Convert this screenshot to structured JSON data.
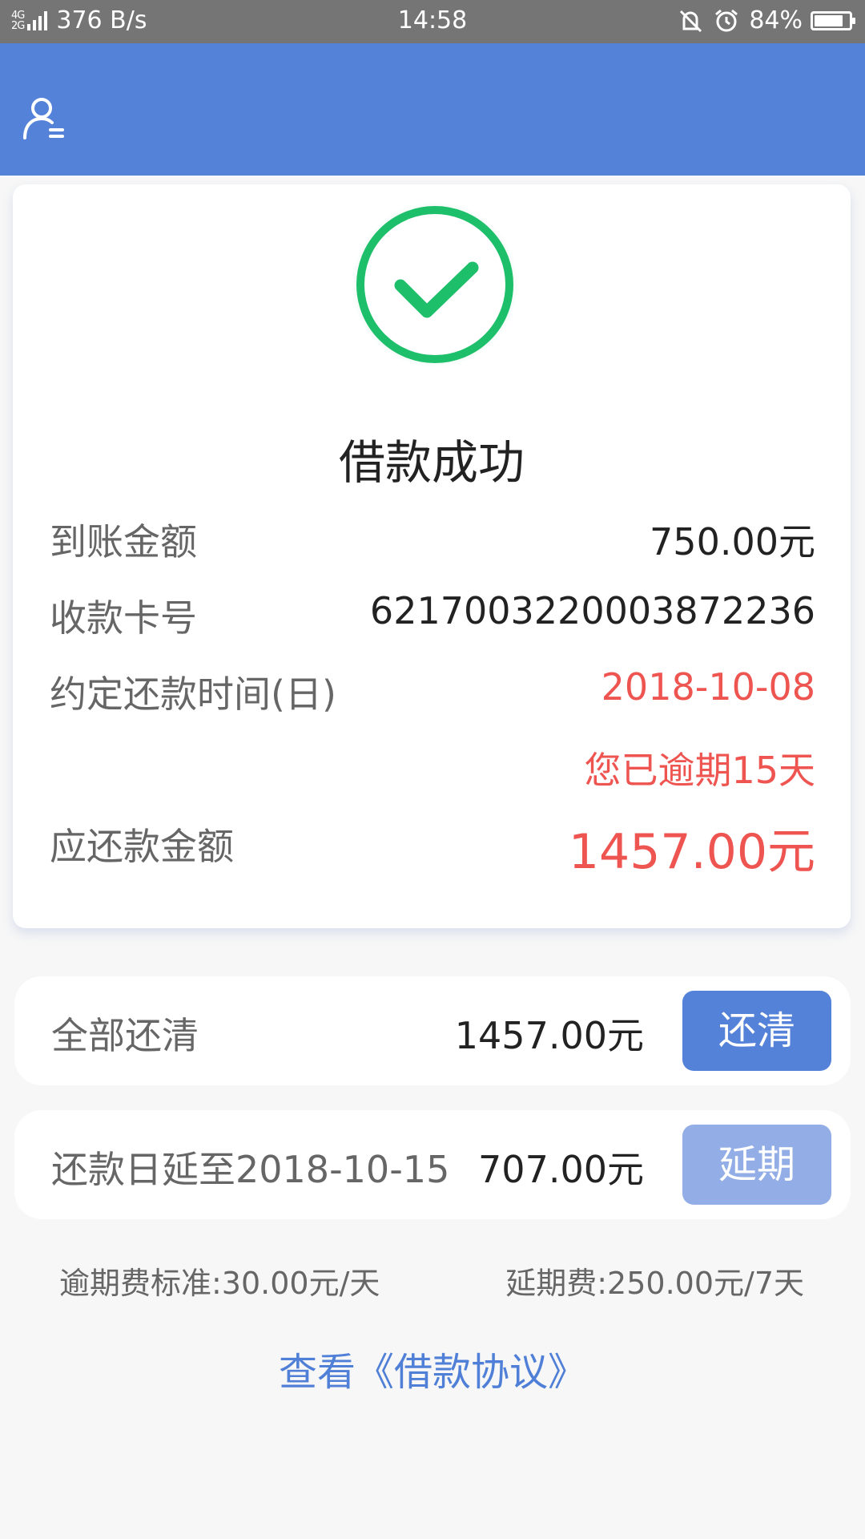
{
  "status_bar": {
    "network": "4G 2G",
    "speed": "376 B/s",
    "time": "14:58",
    "battery_percent": "84%",
    "battery_level": 0.84,
    "icons": [
      "signal-icon",
      "vibrate-mute-icon",
      "alarm-icon",
      "battery-icon"
    ]
  },
  "header": {
    "user_icon": "user-menu-icon",
    "accent_color": "#5582d9"
  },
  "result": {
    "status_icon": "check-circle-icon",
    "title": "借款成功",
    "rows": {
      "received_label": "到账金额",
      "received_value": "750.00元",
      "card_label": "收款卡号",
      "card_value": "6217003220003872236",
      "due_label": "约定还款时间(日)",
      "due_value": "2018-10-08",
      "overdue_notice": "您已逾期15天",
      "payable_label": "应还款金额",
      "payable_value": "1457.00元"
    }
  },
  "actions": [
    {
      "label": "全部还清",
      "amount": "1457.00元",
      "button": "还清",
      "button_color": "#5582d9"
    },
    {
      "label": "还款日延至2018-10-15",
      "amount": "707.00元",
      "button": "延期",
      "button_color": "#93aee6"
    }
  ],
  "fees": {
    "overdue_standard": "逾期费标准:30.00元/天",
    "extension_fee": "延期费:250.00元/7天"
  },
  "agreement_link": "查看《借款协议》",
  "colors": {
    "success": "#1dbf6a",
    "warning": "#ee5450",
    "link": "#4f7fd6"
  }
}
